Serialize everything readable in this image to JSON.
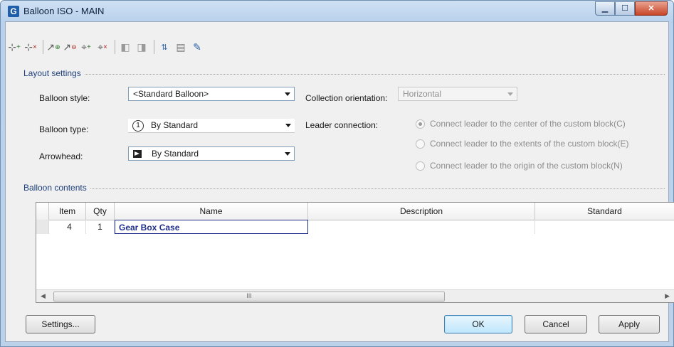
{
  "window": {
    "title": "Balloon ISO - MAIN",
    "icon": "app-logo-icon"
  },
  "toolbar": {
    "icons": [
      "add-balloon-icon",
      "remove-balloon-icon",
      "attach-leader-icon",
      "remove-leader-icon",
      "add-balloon-item-icon",
      "remove-balloon-item-icon",
      "align-balloons-icon",
      "balloon-gap-icon",
      "sort-items-icon",
      "reorder-icon",
      "edit-balloon-icon"
    ]
  },
  "layout": {
    "group_title": "Layout settings",
    "balloon_style": {
      "label": "Balloon style:",
      "value": "<Standard Balloon>"
    },
    "balloon_type": {
      "label": "Balloon type:",
      "glyph": "1",
      "value": "By Standard"
    },
    "arrowhead": {
      "label": "Arrowhead:",
      "value": "By Standard"
    },
    "collection_orientation": {
      "label": "Collection orientation:",
      "value": "Horizontal"
    },
    "leader_connection": {
      "label": "Leader connection:",
      "options": [
        {
          "label": "Connect leader to the center of the custom block(C)",
          "selected": true
        },
        {
          "label": "Connect leader to the extents of the custom block(E)",
          "selected": false
        },
        {
          "label": "Connect leader to the origin of the custom block(N)",
          "selected": false
        }
      ]
    }
  },
  "contents": {
    "group_title": "Balloon contents",
    "columns": [
      "Item",
      "Qty",
      "Name",
      "Description",
      "Standard"
    ],
    "rows": [
      {
        "item": "4",
        "qty": "1",
        "name": "Gear Box Case",
        "description": "",
        "standard": ""
      }
    ],
    "scroll_thumb_glyph": "III"
  },
  "buttons": {
    "settings": "Settings...",
    "ok": "OK",
    "cancel": "Cancel",
    "apply": "Apply"
  },
  "colors": {
    "group_title": "#1d3f7a",
    "selected_text": "#1f2e8a",
    "default_button": "#3c7fb1"
  }
}
